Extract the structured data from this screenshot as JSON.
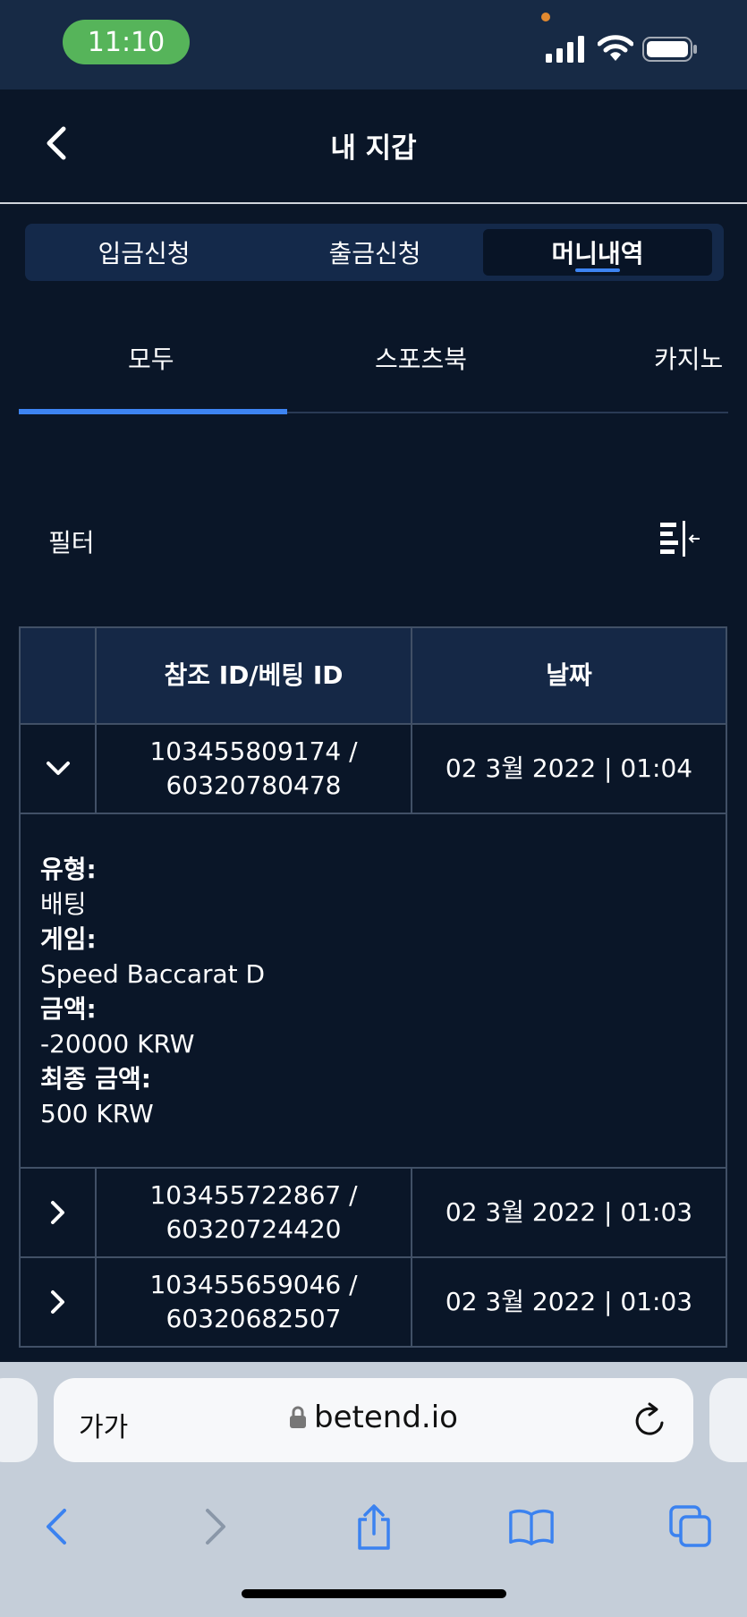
{
  "status": {
    "time": "11:10"
  },
  "header": {
    "title": "내 지갑"
  },
  "top_tabs": [
    {
      "label": "입금신청",
      "active": false
    },
    {
      "label": "출금신청",
      "active": false
    },
    {
      "label": "머니내역",
      "active": true
    }
  ],
  "sub_tabs": [
    {
      "label": "모두",
      "active": true
    },
    {
      "label": "스포츠북",
      "active": false
    },
    {
      "label": "카지노",
      "active": false
    }
  ],
  "filter": {
    "label": "필터"
  },
  "table": {
    "headers": [
      "",
      "참조 ID/베팅 ID",
      "날짜"
    ],
    "rows": [
      {
        "ref_line1": "103455809174 /",
        "ref_line2": "60320780478",
        "date": "02 3월 2022 | 01:04",
        "expanded": true
      },
      {
        "ref_line1": "103455722867 /",
        "ref_line2": "60320724420",
        "date": "02 3월 2022 | 01:03",
        "expanded": false
      },
      {
        "ref_line1": "103455659046 /",
        "ref_line2": "60320682507",
        "date": "02 3월 2022 | 01:03",
        "expanded": false
      }
    ],
    "details": {
      "type_label": "유형:",
      "type_value": "배팅",
      "game_label": "게임:",
      "game_value": "Speed Baccarat D",
      "amount_label": "금액:",
      "amount_value": "-20000 KRW",
      "final_label": "최종 금액:",
      "final_value": "500 KRW"
    }
  },
  "browser": {
    "aa_label": "가가",
    "host": "betend.io"
  },
  "colors": {
    "accent": "#3d84f2",
    "background": "#0a1628",
    "status_green": "#56b45a"
  }
}
